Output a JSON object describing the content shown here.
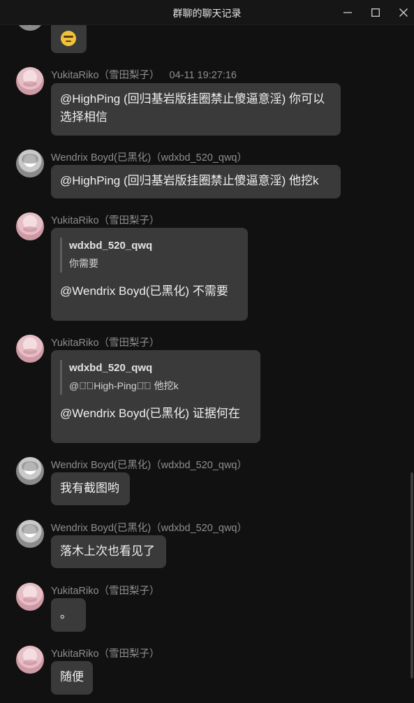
{
  "window": {
    "title": "群聊的聊天记录"
  },
  "messages": [
    {
      "sender": "",
      "time": "",
      "text": "",
      "emoji": "smiling-face-emoji"
    },
    {
      "sender": "YukitaRiko（雪田梨子）",
      "time": "04-11 19:27:16",
      "text": "@HighPing (回归基岩版挂圈禁止傻逼意淫) 你可以选择相信"
    },
    {
      "sender": "Wendrix Boyd(已黑化)（wdxbd_520_qwq）",
      "text": "@HighPing (回归基岩版挂圈禁止傻逼意淫) 他挖k"
    },
    {
      "sender": "YukitaRiko（雪田梨子）",
      "quote": {
        "name": "wdxbd_520_qwq",
        "text": "你需要"
      },
      "text": "@Wendrix Boyd(已黑化) 不需要"
    },
    {
      "sender": "YukitaRiko（雪田梨子）",
      "quote": {
        "name": "wdxbd_520_qwq",
        "text": "@◡̈⃝High-Ping◡̈⃝ 他挖k"
      },
      "text": "@Wendrix Boyd(已黑化) 证据何在"
    },
    {
      "sender": "Wendrix Boyd(已黑化)（wdxbd_520_qwq）",
      "text": "我有截图哟"
    },
    {
      "sender": "Wendrix Boyd(已黑化)（wdxbd_520_qwq）",
      "text": "落木上次也看见了"
    },
    {
      "sender": "YukitaRiko（雪田梨子）",
      "text": "。"
    },
    {
      "sender": "YukitaRiko（雪田梨子）",
      "text": "随便"
    }
  ],
  "colors": {
    "background": "#111111",
    "bubble": "#3a3a3a",
    "sender_text": "#8e8e8e",
    "message_text": "#f0f0f0"
  }
}
